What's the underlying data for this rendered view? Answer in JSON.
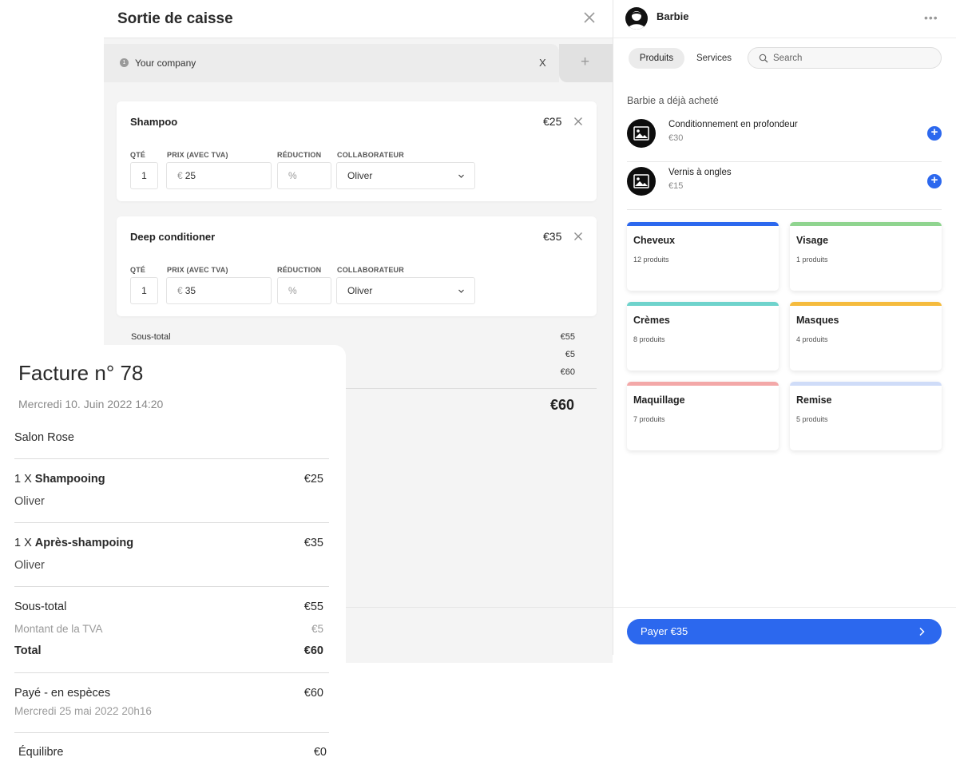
{
  "checkout": {
    "title": "Sortie de caisse",
    "company_tab": {
      "badge": "1",
      "label": "Your company",
      "close": "X"
    },
    "add_tab": "+",
    "items": [
      {
        "name": "Shampoo",
        "price": "€25",
        "qty_label": "QTÉ",
        "price_label": "PRIX (AVEC TVA)",
        "discount_label": "RÉDUCTION",
        "staff_label": "COLLABORATEUR",
        "qty": "1",
        "currency": "€",
        "unit_price": "25",
        "discount_placeholder": "%",
        "staff": "Oliver"
      },
      {
        "name": "Deep conditioner",
        "price": "€35",
        "qty_label": "QTÉ",
        "price_label": "PRIX (AVEC TVA)",
        "discount_label": "RÉDUCTION",
        "staff_label": "COLLABORATEUR",
        "qty": "1",
        "currency": "€",
        "unit_price": "35",
        "discount_placeholder": "%",
        "staff": "Oliver"
      }
    ],
    "summary": {
      "subtotal_label": "Sous-total",
      "subtotal": "€55",
      "tax": "€5",
      "total_line": "€60",
      "grand_total": "€60"
    }
  },
  "client_panel": {
    "client_name": "Barbie",
    "more": "•••",
    "tabs": {
      "products": "Produits",
      "services": "Services"
    },
    "search_placeholder": "Search",
    "already_bought_title": "Barbie a déjà acheté",
    "already_bought": [
      {
        "name": "Conditionnement en profondeur",
        "price": "€30"
      },
      {
        "name": "Vernis à ongles",
        "price": "€15"
      }
    ],
    "categories": [
      {
        "name": "Cheveux",
        "count": "12 produits",
        "color": "#2c68ee"
      },
      {
        "name": "Visage",
        "count": "1 produits",
        "color": "#8fd48f"
      },
      {
        "name": "Crèmes",
        "count": "8 produits",
        "color": "#6fd3cc"
      },
      {
        "name": "Masques",
        "count": "4 produits",
        "color": "#f5bb3d"
      },
      {
        "name": "Maquillage",
        "count": "7 produits",
        "color": "#f3a8a8"
      },
      {
        "name": "Remise",
        "count": "5 produits",
        "color": "#cfdcf8"
      }
    ],
    "pay_button": "Payer €35"
  },
  "invoice": {
    "title": "Facture n° 78",
    "date": "Mercredi 10. Juin 2022 14:20",
    "salon": "Salon Rose",
    "lines": [
      {
        "qty": "1 X ",
        "name": "Shampooing",
        "price": "€25",
        "staff": "Oliver"
      },
      {
        "qty": "1 X ",
        "name": "Après-shampoing",
        "price": "€35",
        "staff": "Oliver"
      }
    ],
    "subtotal_label": "Sous-total",
    "subtotal": "€55",
    "vat_label": "Montant de la TVA",
    "vat": "€5",
    "total_label": "Total",
    "total": "€60",
    "payment_label": "Payé - en espèces",
    "payment": "€60",
    "payment_date": "Mercredi 25 mai 2022 20h16",
    "balance_label": "Équilibre",
    "balance": "€0"
  },
  "colors": {
    "accent": "#2c68ee"
  }
}
